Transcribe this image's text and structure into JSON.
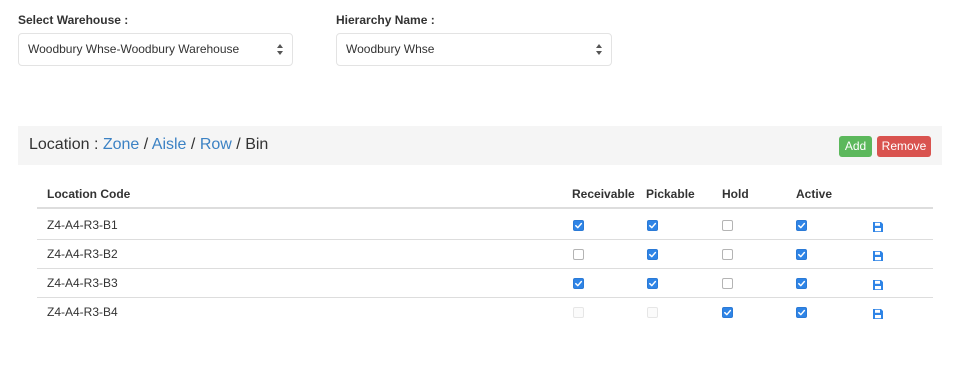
{
  "warehouse": {
    "label": "Select Warehouse :",
    "value": "Woodbury Whse-Woodbury Warehouse"
  },
  "hierarchy": {
    "label": "Hierarchy Name :",
    "value": "Woodbury Whse"
  },
  "location": {
    "prefix": "Location : ",
    "levels": [
      "Zone",
      "Aisle",
      "Row",
      "Bin"
    ],
    "separator": "/"
  },
  "buttons": {
    "add": "Add",
    "remove": "Remove"
  },
  "colors": {
    "add": "#5cb85c",
    "remove": "#d9534f",
    "link": "#3c82c4",
    "checkbox_checked": "#2e84e6"
  },
  "table": {
    "columns": [
      "Location Code",
      "Receivable",
      "Pickable",
      "Hold",
      "Active"
    ],
    "rows": [
      {
        "code": "Z4-A4-R3-B1",
        "receivable": true,
        "pickable": true,
        "hold": false,
        "active": true,
        "receivable_disabled": false,
        "pickable_disabled": false,
        "action_icon": "save-icon"
      },
      {
        "code": "Z4-A4-R3-B2",
        "receivable": false,
        "pickable": true,
        "hold": false,
        "active": true,
        "receivable_disabled": false,
        "pickable_disabled": false,
        "action_icon": "save-icon"
      },
      {
        "code": "Z4-A4-R3-B3",
        "receivable": true,
        "pickable": true,
        "hold": false,
        "active": true,
        "receivable_disabled": false,
        "pickable_disabled": false,
        "action_icon": "save-icon"
      },
      {
        "code": "Z4-A4-R3-B4",
        "receivable": false,
        "pickable": false,
        "hold": true,
        "active": true,
        "receivable_disabled": true,
        "pickable_disabled": true,
        "action_icon": "save-icon"
      }
    ]
  }
}
